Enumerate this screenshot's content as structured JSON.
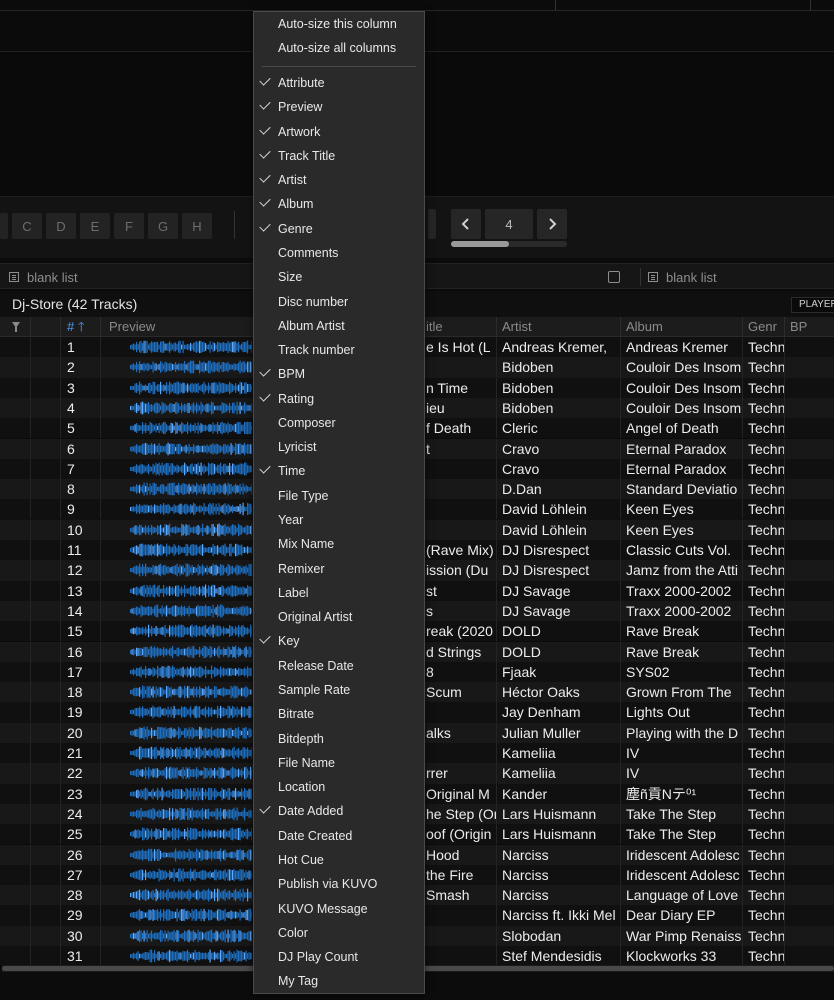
{
  "hot_cues": [
    "C",
    "D",
    "E",
    "F",
    "G",
    "H"
  ],
  "pager": {
    "prev_icon": "chevron-left-icon",
    "page": "4",
    "next_icon": "chevron-right-icon",
    "progress": 0.5
  },
  "list_bar": {
    "left_list": "blank list",
    "right_list": "blank list"
  },
  "playlist_title": "Dj-Store (42 Tracks)",
  "player_label": "PLAYER",
  "columns": {
    "number": "#",
    "preview": "Preview",
    "title": "itle",
    "artist": "Artist",
    "album": "Album",
    "genre": "Genr",
    "bpm": "BP"
  },
  "rows": [
    {
      "n": "1",
      "title": "e Is Hot (L",
      "artist": "Andreas Kremer,",
      "album": "Andreas Kremer",
      "genre": "Techno"
    },
    {
      "n": "2",
      "title": "",
      "artist": "Bidoben",
      "album": "Couloir Des Insom",
      "genre": "Techno"
    },
    {
      "n": "3",
      "title": "n Time",
      "artist": "Bidoben",
      "album": "Couloir Des Insom",
      "genre": "Techno"
    },
    {
      "n": "4",
      "title": "ieu",
      "artist": "Bidoben",
      "album": "Couloir Des Insom",
      "genre": "Techno"
    },
    {
      "n": "5",
      "title": "f Death",
      "artist": "Cleric",
      "album": "Angel of Death",
      "genre": "Techno"
    },
    {
      "n": "6",
      "title": "t",
      "artist": "Cravo",
      "album": "Eternal Paradox",
      "genre": "Techno"
    },
    {
      "n": "7",
      "title": "",
      "artist": "Cravo",
      "album": "Eternal Paradox",
      "genre": "Techno"
    },
    {
      "n": "8",
      "title": "",
      "artist": "D.Dan",
      "album": "Standard Deviatio",
      "genre": "Techno"
    },
    {
      "n": "9",
      "title": "",
      "artist": "David Löhlein",
      "album": "Keen Eyes",
      "genre": "Techno"
    },
    {
      "n": "10",
      "title": "",
      "artist": "David Löhlein",
      "album": "Keen Eyes",
      "genre": "Techno"
    },
    {
      "n": "11",
      "title": "(Rave Mix)",
      "artist": "DJ Disrespect",
      "album": "Classic Cuts Vol.",
      "genre": "Techno"
    },
    {
      "n": "12",
      "title": "ission (Du",
      "artist": "DJ Disrespect",
      "album": "Jamz from the Atti",
      "genre": "Techno"
    },
    {
      "n": "13",
      "title": "st",
      "artist": "DJ Savage",
      "album": "Traxx 2000-2002",
      "genre": "Techno"
    },
    {
      "n": "14",
      "title": "s",
      "artist": "DJ Savage",
      "album": "Traxx 2000-2002",
      "genre": "Techno"
    },
    {
      "n": "15",
      "title": "reak (2020",
      "artist": "DOLD",
      "album": "Rave Break",
      "genre": "Techno"
    },
    {
      "n": "16",
      "title": "d Strings",
      "artist": "DOLD",
      "album": "Rave Break",
      "genre": "Techno"
    },
    {
      "n": "17",
      "title": "8",
      "artist": "Fjaak",
      "album": "SYS02",
      "genre": "Techno"
    },
    {
      "n": "18",
      "title": "Scum",
      "artist": "Héctor Oaks",
      "album": "Grown From The",
      "genre": "Techno"
    },
    {
      "n": "19",
      "title": "",
      "artist": "Jay Denham",
      "album": "Lights Out",
      "genre": "Techno"
    },
    {
      "n": "20",
      "title": "alks",
      "artist": "Julian Muller",
      "album": "Playing with the D",
      "genre": "Techno"
    },
    {
      "n": "21",
      "title": "",
      "artist": "Kameliia",
      "album": "IV",
      "genre": "Techno"
    },
    {
      "n": "22",
      "title": "rrer",
      "artist": "Kameliia",
      "album": "IV",
      "genre": "Techno"
    },
    {
      "n": "23",
      "title": "Original M",
      "artist": "Kander",
      "album": "塵ñ貢Nテ⁰¹",
      "genre": "Techno"
    },
    {
      "n": "24",
      "title": "he Step (Or",
      "artist": "Lars Huismann",
      "album": "Take The Step",
      "genre": "Techno"
    },
    {
      "n": "25",
      "title": "oof (Origin",
      "artist": "Lars Huismann",
      "album": "Take The Step",
      "genre": "Techno"
    },
    {
      "n": "26",
      "title": "Hood",
      "artist": "Narciss",
      "album": "Iridescent Adolesc",
      "genre": "Techno"
    },
    {
      "n": "27",
      "title": "the Fire",
      "artist": "Narciss",
      "album": "Iridescent Adolesc",
      "genre": "Techno"
    },
    {
      "n": "28",
      "title": "Smash",
      "artist": "Narciss",
      "album": "Language of Love",
      "genre": "Techno"
    },
    {
      "n": "29",
      "title": "",
      "artist": "Narciss ft. Ikki Mel",
      "album": "Dear Diary EP",
      "genre": "Techno"
    },
    {
      "n": "30",
      "title": "",
      "artist": "Slobodan",
      "album": "War Pimp Renaiss",
      "genre": "Techno"
    },
    {
      "n": "31",
      "title": "",
      "artist": "Stef Mendesidis",
      "album": "Klockworks 33",
      "genre": "Techno"
    }
  ],
  "menu": {
    "top_items": [
      "Auto-size this column",
      "Auto-size all columns"
    ],
    "items": [
      {
        "label": "Attribute",
        "checked": true
      },
      {
        "label": "Preview",
        "checked": true
      },
      {
        "label": "Artwork",
        "checked": true
      },
      {
        "label": "Track Title",
        "checked": true
      },
      {
        "label": "Artist",
        "checked": true
      },
      {
        "label": "Album",
        "checked": true
      },
      {
        "label": "Genre",
        "checked": true
      },
      {
        "label": "Comments",
        "checked": false
      },
      {
        "label": "Size",
        "checked": false
      },
      {
        "label": "Disc number",
        "checked": false
      },
      {
        "label": "Album Artist",
        "checked": false
      },
      {
        "label": "Track number",
        "checked": false
      },
      {
        "label": "BPM",
        "checked": true
      },
      {
        "label": "Rating",
        "checked": true
      },
      {
        "label": "Composer",
        "checked": false
      },
      {
        "label": "Lyricist",
        "checked": false
      },
      {
        "label": "Time",
        "checked": true
      },
      {
        "label": "File Type",
        "checked": false
      },
      {
        "label": "Year",
        "checked": false
      },
      {
        "label": "Mix Name",
        "checked": false
      },
      {
        "label": "Remixer",
        "checked": false
      },
      {
        "label": "Label",
        "checked": false
      },
      {
        "label": "Original Artist",
        "checked": false
      },
      {
        "label": "Key",
        "checked": true
      },
      {
        "label": "Release Date",
        "checked": false
      },
      {
        "label": "Sample Rate",
        "checked": false
      },
      {
        "label": "Bitrate",
        "checked": false
      },
      {
        "label": "Bitdepth",
        "checked": false
      },
      {
        "label": "File Name",
        "checked": false
      },
      {
        "label": "Location",
        "checked": false
      },
      {
        "label": "Date Added",
        "checked": true
      },
      {
        "label": "Date Created",
        "checked": false
      },
      {
        "label": "Hot Cue",
        "checked": false
      },
      {
        "label": "Publish via KUVO",
        "checked": false
      },
      {
        "label": "KUVO Message",
        "checked": false
      },
      {
        "label": "Color",
        "checked": false
      },
      {
        "label": "DJ Play Count",
        "checked": false
      },
      {
        "label": "My Tag",
        "checked": false
      }
    ]
  },
  "colors": {
    "accent": "#4d9bff",
    "waveform": "#1e6fc0",
    "menu_bg": "#2a2a2a"
  }
}
